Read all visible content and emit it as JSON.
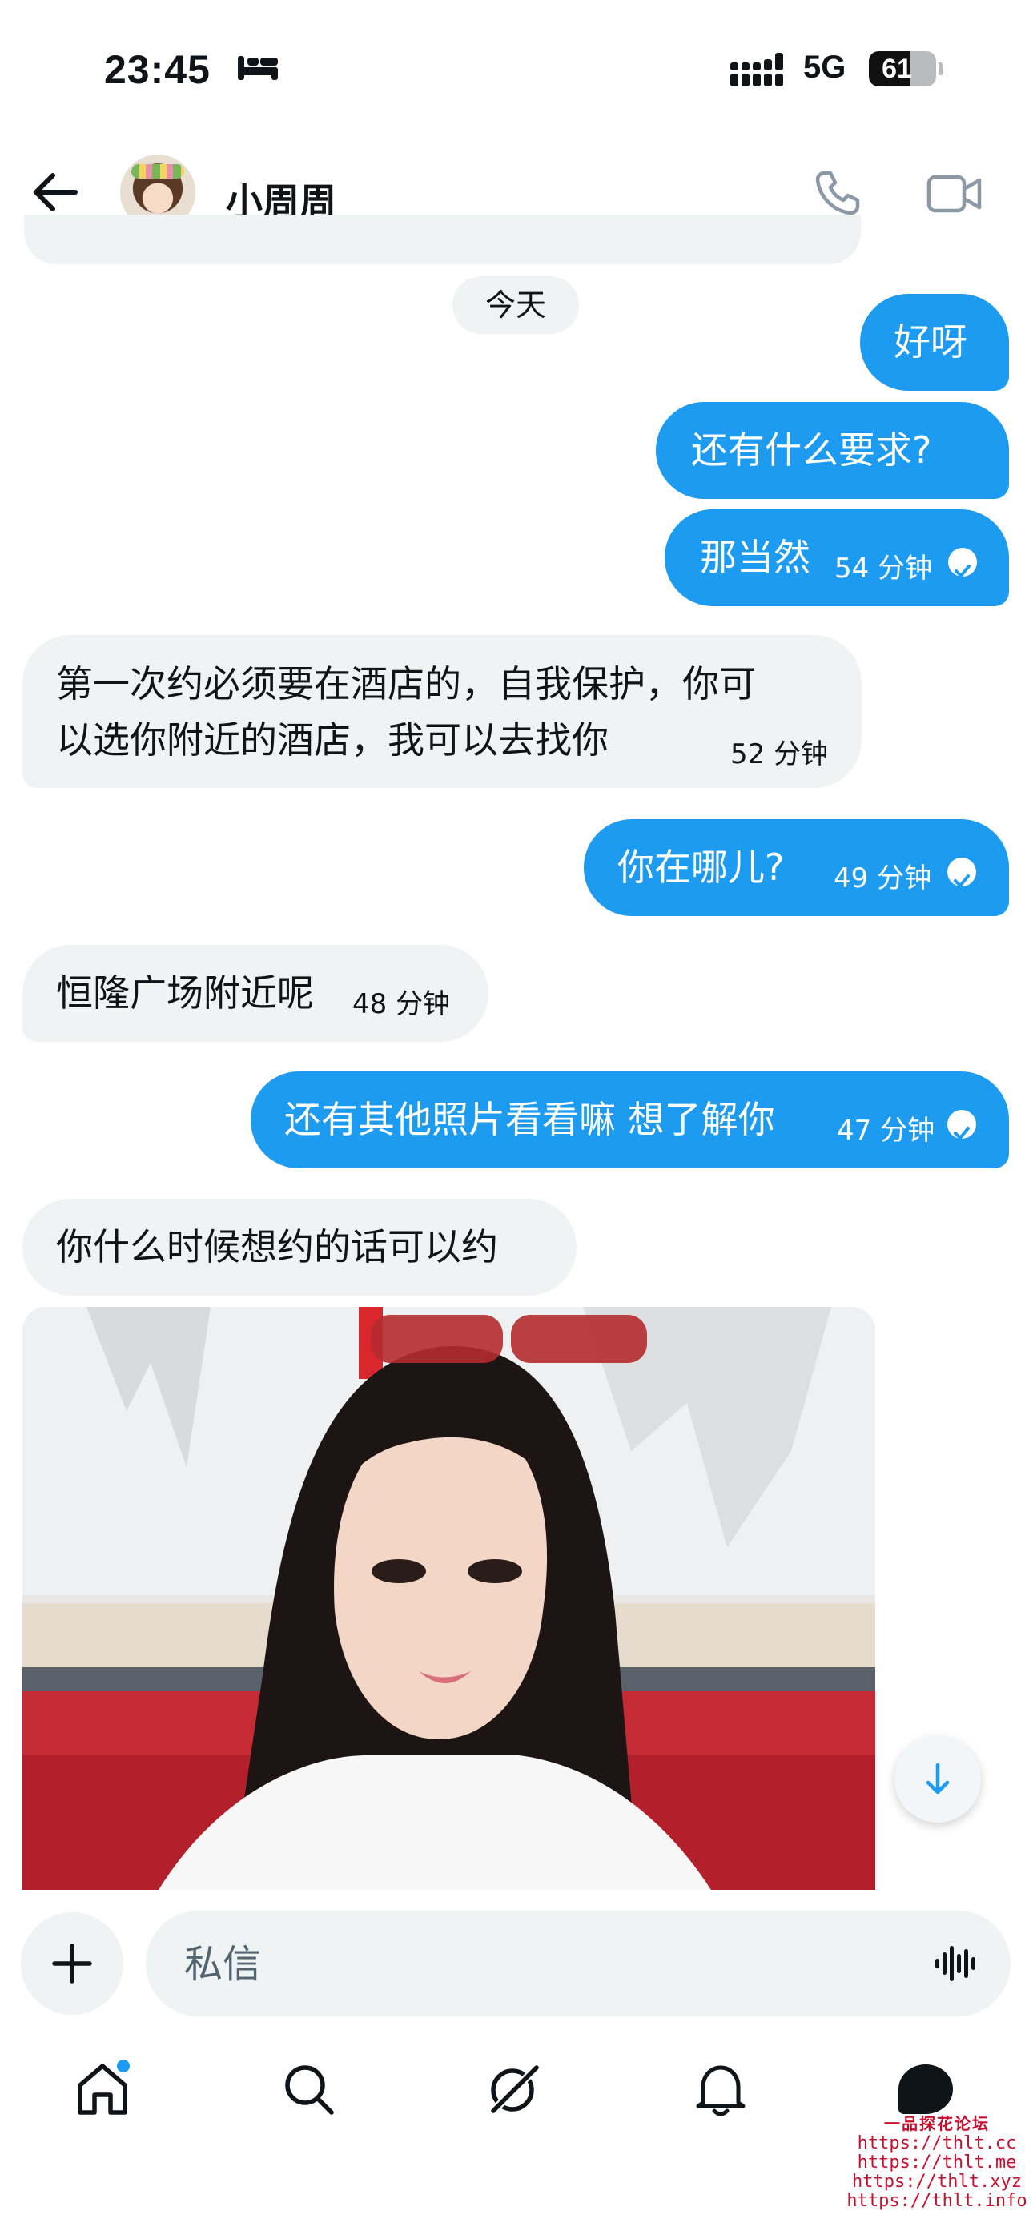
{
  "status_bar": {
    "time": "23:45",
    "network": "5G",
    "battery": "61",
    "battery_level": 0.61,
    "icons": [
      "bed-icon",
      "cellular-signal-icon",
      "battery-icon"
    ]
  },
  "header": {
    "contact_name": "小周周",
    "icons": [
      "back-arrow-icon",
      "avatar",
      "phone-icon",
      "video-camera-icon"
    ]
  },
  "date_divider": "今天",
  "messages": [
    {
      "dir": "out",
      "text": "好呀",
      "time": "",
      "read": false
    },
    {
      "dir": "out",
      "text": "还有什么要求?",
      "time": "",
      "read": false
    },
    {
      "dir": "out",
      "text": "那当然",
      "time": "54 分钟",
      "read": true
    },
    {
      "dir": "in",
      "lines": [
        "第一次约必须要在酒店的，自我保护，你可",
        "以选你附近的酒店，我可以去找你"
      ],
      "time": "52 分钟"
    },
    {
      "dir": "out",
      "text": "你在哪儿?",
      "time": "49 分钟",
      "read": true
    },
    {
      "dir": "in",
      "text": "恒隆广场附近呢",
      "time": "48 分钟"
    },
    {
      "dir": "out",
      "text": "还有其他照片看看嘛 想了解你",
      "time": "47 分钟",
      "read": true
    },
    {
      "dir": "in",
      "text": "你什么时候想约的话可以约",
      "time": ""
    }
  ],
  "composer": {
    "placeholder": "私信",
    "icons": [
      "plus-icon",
      "voice-waveform-icon"
    ]
  },
  "scroll_button": {
    "icon": "arrow-down-icon"
  },
  "tab_bar": {
    "items": [
      "home-icon",
      "search-icon",
      "grok-icon",
      "bell-icon",
      "messages-icon"
    ],
    "home_has_notification": true
  },
  "watermark": {
    "title": "一品探花论坛",
    "urls": [
      "https://thlt.cc",
      "https://thlt.me",
      "https://thlt.xyz",
      "https://thlt.info"
    ]
  },
  "colors": {
    "accent": "#1d9bf0",
    "incoming_bubble": "#eff3f4",
    "text": "#0f1419",
    "watermark": "#c8102e"
  }
}
